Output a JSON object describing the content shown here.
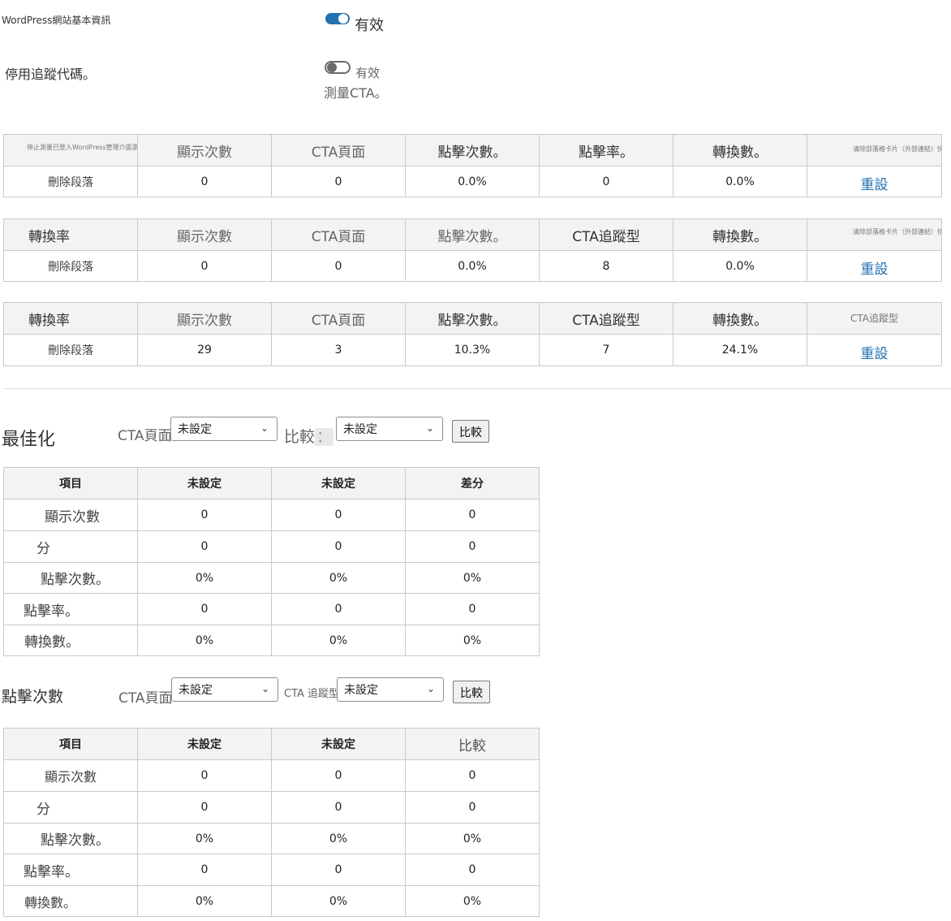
{
  "settings": {
    "basic_info_label": "WordPress網站基本資訊",
    "basic_info_toggle_text": "有效",
    "disable_tracking_label": "停用追蹤代碼。",
    "disable_tracking_toggle_text": "有效",
    "measure_cta_text": "測量CTA。"
  },
  "stats_tables": [
    {
      "headers": [
        "停止測量已登入WordPress管理介面瀏覽器的CTA",
        "顯示次數",
        "CTA頁面",
        "點擊次數。",
        "點擊率。",
        "轉換數。",
        "清除部落格卡片（外部連結）快取"
      ],
      "row": [
        "刪除段落",
        "0",
        "0",
        "0.0%",
        "0",
        "0.0%",
        "重設"
      ]
    },
    {
      "headers": [
        "轉換率",
        "顯示次數",
        "CTA頁面",
        "點擊次數。",
        "CTA追蹤型",
        "轉換數。",
        "清除部落格卡片（外部連結）快取"
      ],
      "row": [
        "刪除段落",
        "0",
        "0",
        "0.0%",
        "8",
        "0.0%",
        "重設"
      ]
    },
    {
      "headers": [
        "轉換率",
        "顯示次數",
        "CTA頁面",
        "點擊次數。",
        "CTA追蹤型",
        "轉換數。",
        "CTA追蹤型"
      ],
      "row": [
        "刪除段落",
        "29",
        "3",
        "10.3%",
        "7",
        "24.1%",
        "重設"
      ]
    }
  ],
  "optimize": {
    "title": "最佳化",
    "cta_page_label": "CTA頁面",
    "select1": "未設定",
    "compare_label": "比較",
    "compare_colon": "：",
    "select2": "未設定",
    "compare_button": "比較",
    "table": {
      "headers": [
        "項目",
        "未設定",
        "未設定",
        "差分"
      ],
      "rows": [
        [
          "顯示次數",
          "0",
          "0",
          "0"
        ],
        [
          "分",
          "0",
          "0",
          "0"
        ],
        [
          "點擊次數。",
          "0%",
          "0%",
          "0%"
        ],
        [
          "點擊率。",
          "0",
          "0",
          "0"
        ],
        [
          "轉換數。",
          "0%",
          "0%",
          "0%"
        ]
      ]
    }
  },
  "clicks": {
    "title": "點擊次數",
    "cta_page_label": "CTA頁面",
    "select1": "未設定",
    "tracking_label": "CTA 追蹤型",
    "select2": "未設定",
    "compare_button": "比較",
    "table": {
      "headers": [
        "項目",
        "未設定",
        "未設定",
        "比較"
      ],
      "rows": [
        [
          "顯示次數",
          "0",
          "0",
          "0"
        ],
        [
          "分",
          "0",
          "0",
          "0"
        ],
        [
          "點擊次數。",
          "0%",
          "0%",
          "0%"
        ],
        [
          "點擊率。",
          "0",
          "0",
          "0"
        ],
        [
          "轉換數。",
          "0%",
          "0%",
          "0%"
        ]
      ]
    }
  },
  "colors": {
    "accent": "#2271b1",
    "header_bg": "#f3f3f3",
    "border": "#c9c9c9"
  }
}
